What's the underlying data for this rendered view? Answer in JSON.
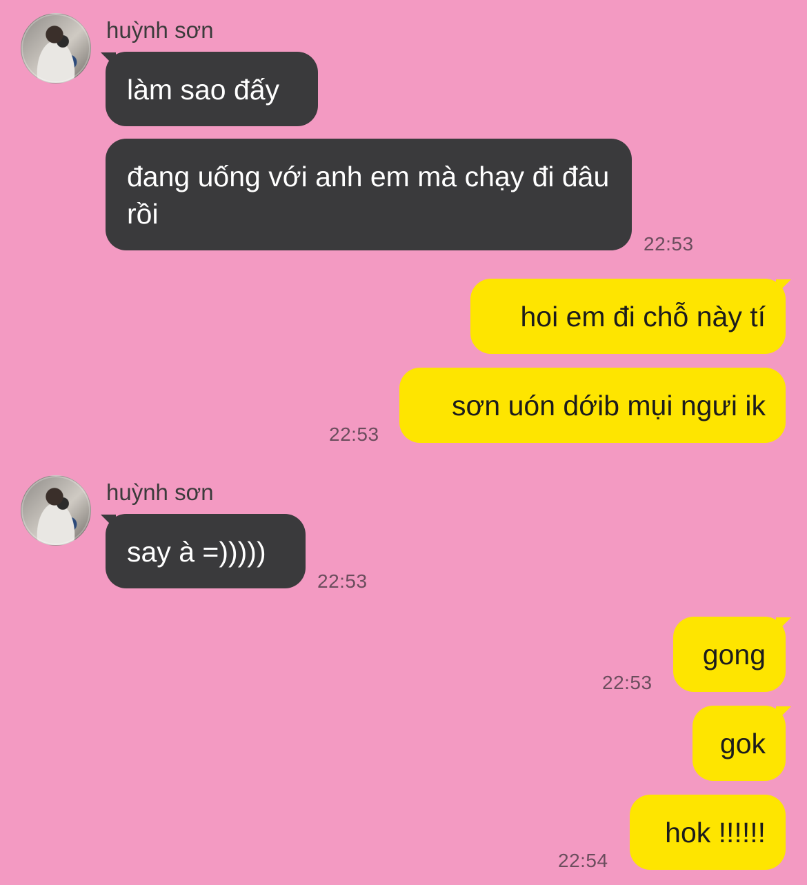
{
  "chat": {
    "groups": [
      {
        "sender": "huỳnh sơn",
        "messages": [
          "làm sao đấy",
          "đang uống với anh em mà chạy đi đâu rồi"
        ],
        "time": "22:53"
      },
      {
        "sender": "me",
        "messages": [
          "hoi em đi chỗ này tí",
          "sơn uón dớib mụi ngưi ik"
        ],
        "time": "22:53"
      },
      {
        "sender": "huỳnh sơn",
        "messages": [
          "say à =)))))"
        ],
        "time": "22:53"
      },
      {
        "sender": "me",
        "messages": [
          "gong"
        ],
        "time": "22:53"
      },
      {
        "sender": "me",
        "messages": [
          "gok",
          "hok !!!!!!"
        ],
        "time": "22:54"
      }
    ]
  },
  "colors": {
    "background": "#f39ac2",
    "incoming_bubble": "#3a3a3c",
    "outgoing_bubble": "#fee500"
  },
  "icons": [
    "avatar-photo"
  ]
}
